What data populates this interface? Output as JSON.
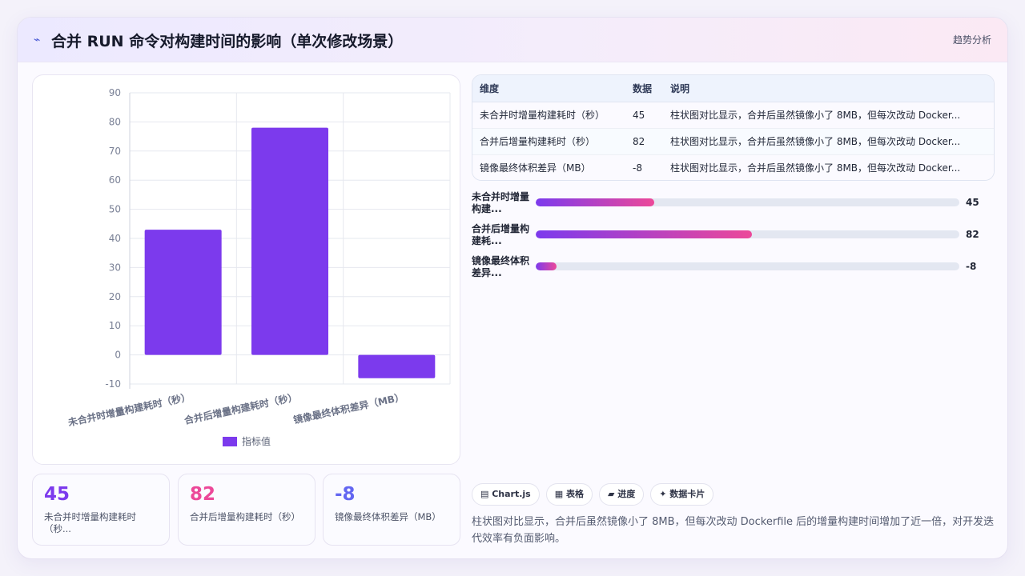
{
  "header": {
    "title": "合并 RUN 命令对构建时间的影响（单次修改场景）",
    "tag": "趋势分析"
  },
  "chart_data": {
    "type": "bar",
    "categories": [
      "未合并时增量构建耗时（秒）",
      "合并后增量构建耗时（秒）",
      "镜像最终体积差异（MB）"
    ],
    "series": [
      {
        "name": "指标值",
        "values": [
          43,
          78,
          -8
        ]
      }
    ],
    "ylim": [
      -10,
      90
    ],
    "yticks": [
      -10,
      0,
      10,
      20,
      30,
      40,
      50,
      60,
      70,
      80,
      90
    ],
    "ytick_labels": [
      "-10",
      "0",
      "10",
      "20",
      "30",
      "40",
      "50",
      "60",
      "70",
      "80",
      "90"
    ],
    "bar_color": "#7c3aed",
    "grid": true,
    "legend": "bottom"
  },
  "kpis": [
    {
      "value": "45",
      "label": "未合并时增量构建耗时（秒...",
      "color": "#7c3aed"
    },
    {
      "value": "82",
      "label": "合并后增量构建耗时（秒）",
      "color": "#ec4899"
    },
    {
      "value": "-8",
      "label": "镜像最终体积差异（MB）",
      "color": "#6366f1"
    }
  ],
  "table": {
    "headers": [
      "维度",
      "数据",
      "说明"
    ],
    "rows": [
      [
        "未合并时增量构建耗时（秒）",
        "45",
        "柱状图对比显示，合并后虽然镜像小了 8MB，但每次改动 Docker..."
      ],
      [
        "合并后增量构建耗时（秒）",
        "82",
        "柱状图对比显示，合并后虽然镜像小了 8MB，但每次改动 Docker..."
      ],
      [
        "镜像最终体积差异（MB）",
        "-8",
        "柱状图对比显示，合并后虽然镜像小了 8MB，但每次改动 Docker..."
      ]
    ]
  },
  "progress": [
    {
      "label": "未合并时增量构建...",
      "value": "45",
      "fraction": 0.28
    },
    {
      "label": "合并后增量构建耗...",
      "value": "82",
      "fraction": 0.51
    },
    {
      "label": "镜像最终体积差异...",
      "value": "-8",
      "fraction": 0.05
    }
  ],
  "chips": [
    "▤ Chart.js",
    "▦ 表格",
    "▰ 进度",
    "✦ 数据卡片"
  ],
  "summary": "柱状图对比显示，合并后虽然镜像小了 8MB，但每次改动 Dockerfile 后的增量构建时间增加了近一倍，对开发迭代效率有负面影响。"
}
